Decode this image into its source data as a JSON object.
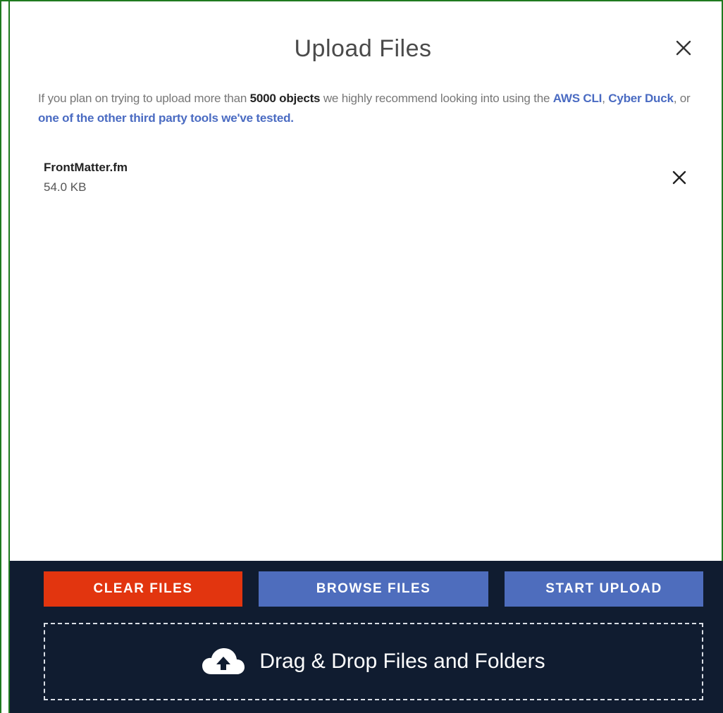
{
  "dialog": {
    "title": "Upload Files",
    "close_icon": "close-icon"
  },
  "notice": {
    "text_1": "If you plan on trying to upload more than ",
    "bold_1": "5000 objects",
    "text_2": " we highly recommend looking into using the ",
    "link_aws": "AWS CLI",
    "text_3": ",  ",
    "link_cyberduck": "Cyber Duck",
    "text_4": ", or ",
    "link_other": "one of the other third party tools we've tested."
  },
  "files": [
    {
      "name": "FrontMatter.fm",
      "size": "54.0 KB",
      "remove_icon": "close-icon"
    }
  ],
  "actions": {
    "clear_label": "CLEAR FILES",
    "browse_label": "BROWSE FILES",
    "start_label": "START UPLOAD"
  },
  "dropzone": {
    "icon": "cloud-upload-icon",
    "label": "Drag & Drop Files and Folders"
  },
  "colors": {
    "clear_button": "#e2350f",
    "primary_button": "#4e6dbd",
    "footer_background": "#101c30",
    "link": "#4a6bc2"
  }
}
